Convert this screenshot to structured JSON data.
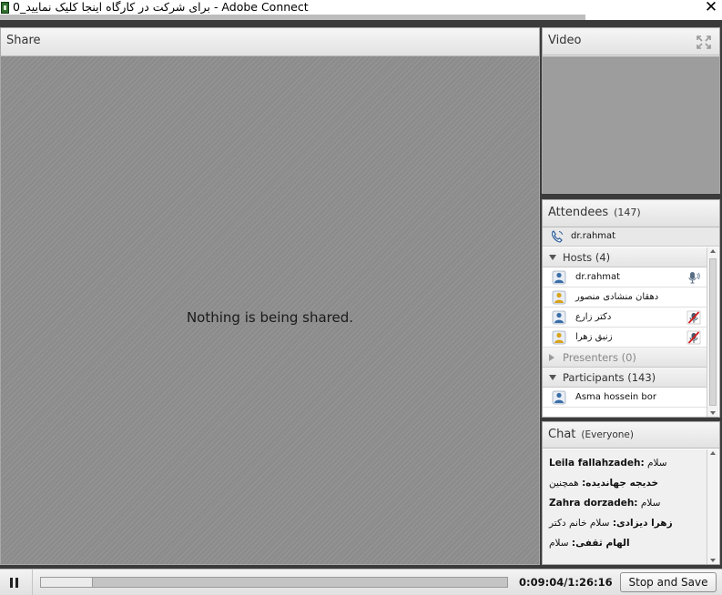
{
  "window": {
    "title": "برای شرکت در کارگاه اینجا کلیک نمایید_0 - Adobe Connect",
    "close_glyph": "✕"
  },
  "share_pod": {
    "title": "Share",
    "empty_message": "Nothing is being shared."
  },
  "video_pod": {
    "title": "Video"
  },
  "attendees_pod": {
    "title": "Attendees",
    "count": "(147)",
    "me": {
      "name": "dr.rahmat",
      "icon": "phone-icon"
    },
    "groups": [
      {
        "label": "Hosts (4)",
        "expanded": true,
        "members": [
          {
            "name": "dr.rahmat",
            "role": "host",
            "mic": "mic-on"
          },
          {
            "name": "دهقان منشادی منصور",
            "role": "host-guest",
            "mic": ""
          },
          {
            "name": "دکتر زارع",
            "role": "host",
            "mic": "mic-muted"
          },
          {
            "name": "زنبق زهرا",
            "role": "host-guest",
            "mic": "mic-muted"
          }
        ]
      },
      {
        "label": "Presenters (0)",
        "expanded": false,
        "members": []
      },
      {
        "label": "Participants (143)",
        "expanded": true,
        "members": [
          {
            "name": "Asma hossein bor",
            "role": "participant",
            "mic": ""
          }
        ]
      }
    ]
  },
  "chat_pod": {
    "title": "Chat",
    "scope": "(Everyone)",
    "messages": [
      {
        "sender": "Leila fallahzadeh:",
        "text": "سلام"
      },
      {
        "sender": "خدیجه جهاندیده:",
        "text": "همچنین"
      },
      {
        "sender": "Zahra dorzadeh:",
        "text": "سلام"
      },
      {
        "sender": "زهرا دیزادی:",
        "text": "سلام خانم دکتر"
      },
      {
        "sender": "الهام ثقفی:",
        "text": "سلام"
      }
    ]
  },
  "playback": {
    "progress": 0.112,
    "time": "0:09:04/1:26:16",
    "stop_label": "Stop and Save"
  }
}
